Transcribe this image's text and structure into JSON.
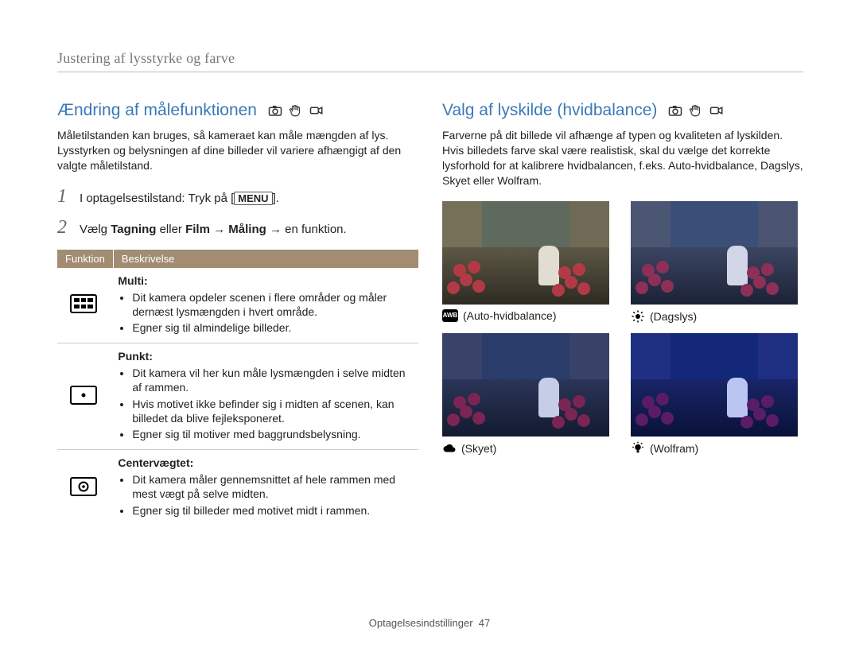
{
  "section_title": "Justering af lysstyrke og farve",
  "left": {
    "heading": "Ændring af målefunktionen",
    "intro": "Måletilstanden kan bruges, så kameraet kan måle mængden af lys. Lysstyrken og belysningen af dine billeder vil variere afhængigt af den valgte måletilstand.",
    "step1_prefix": "I optagelsestilstand: Tryk på [",
    "step1_menu": "MENU",
    "step1_suffix": "].",
    "step2_parts": {
      "pre": "Vælg ",
      "b1": "Tagning",
      "mid1": " eller ",
      "b2": "Film",
      "arrow1": " → ",
      "b3": "Måling",
      "arrow2": " → en funktion."
    },
    "table": {
      "head_func": "Funktion",
      "head_desc": "Beskrivelse",
      "rows": [
        {
          "title": "Multi",
          "bullets": [
            "Dit kamera opdeler scenen i flere områder og måler dernæst lysmængden i hvert område.",
            "Egner sig til almindelige billeder."
          ]
        },
        {
          "title": "Punkt",
          "bullets": [
            "Dit kamera vil her kun måle lysmængden i selve midten af rammen.",
            "Hvis motivet ikke befinder sig i midten af scenen, kan billedet da blive fejleksponeret.",
            "Egner sig til motiver med baggrundsbelysning."
          ]
        },
        {
          "title": "Centervægtet",
          "bullets": [
            "Dit kamera måler gennemsnittet af hele rammen med mest vægt på selve midten.",
            "Egner sig til billeder med motivet midt i rammen."
          ]
        }
      ]
    }
  },
  "right": {
    "heading": "Valg af lyskilde (hvidbalance)",
    "intro": "Farverne på dit billede vil afhænge af typen og kvaliteten af lyskilden. Hvis billedets farve skal være realistisk, skal du vælge det korrekte lysforhold for at kalibrere hvidbalancen, f.eks. Auto-hvidbalance, Dagslys, Skyet eller Wolfram.",
    "wb": {
      "awb_icon": "AWB",
      "awb": "(Auto-hvidbalance)",
      "day": "(Dagslys)",
      "cloud": "(Skyet)",
      "tung": "(Wolfram)"
    }
  },
  "footer": {
    "label": "Optagelsesindstillinger",
    "page": "47"
  }
}
